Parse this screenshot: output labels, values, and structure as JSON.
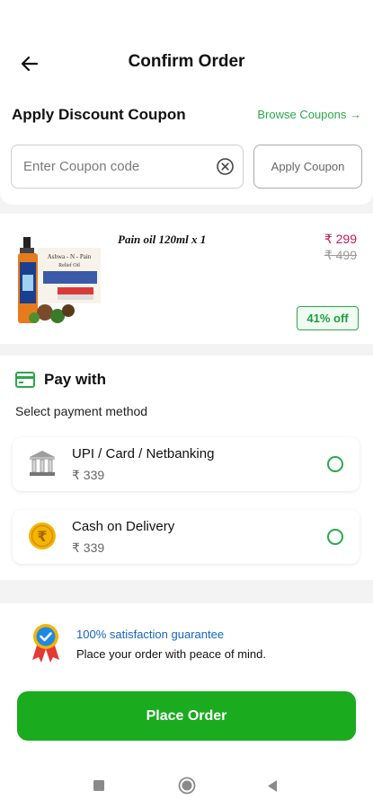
{
  "header": {
    "title": "Confirm Order",
    "back_icon": "arrow-left-icon"
  },
  "coupon": {
    "title": "Apply Discount Coupon",
    "browse_label": "Browse Coupons →",
    "input_placeholder": "Enter Coupon code",
    "input_value": "",
    "apply_label": "Apply Coupon",
    "clear_icon": "clear-circle-icon"
  },
  "product": {
    "name": "Pain oil 120ml x 1",
    "price": "₹ 299",
    "original_price": "₹ 499",
    "discount": "41% off",
    "image_label": "Ashwa - N - Pain Relief Oil"
  },
  "payment": {
    "title": "Pay with",
    "subtitle": "Select payment method",
    "options": [
      {
        "name": "UPI / Card / Netbanking",
        "price": "₹ 339",
        "icon": "bank-icon",
        "selected": false
      },
      {
        "name": "Cash on Delivery",
        "price": "₹ 339",
        "icon": "rupee-coin-icon",
        "selected": false
      }
    ]
  },
  "guarantee": {
    "title": "100% satisfaction guarantee",
    "subtitle": "Place your order with peace of mind.",
    "icon": "medal-icon"
  },
  "actions": {
    "place_order_label": "Place Order"
  },
  "nav": {
    "icons": [
      "recent-apps-icon",
      "home-icon",
      "back-icon"
    ]
  },
  "colors": {
    "accent_green": "#1aab1f",
    "link_green": "#2aa84a",
    "price_pink": "#c2185b",
    "guarantee_blue": "#1565c0"
  }
}
